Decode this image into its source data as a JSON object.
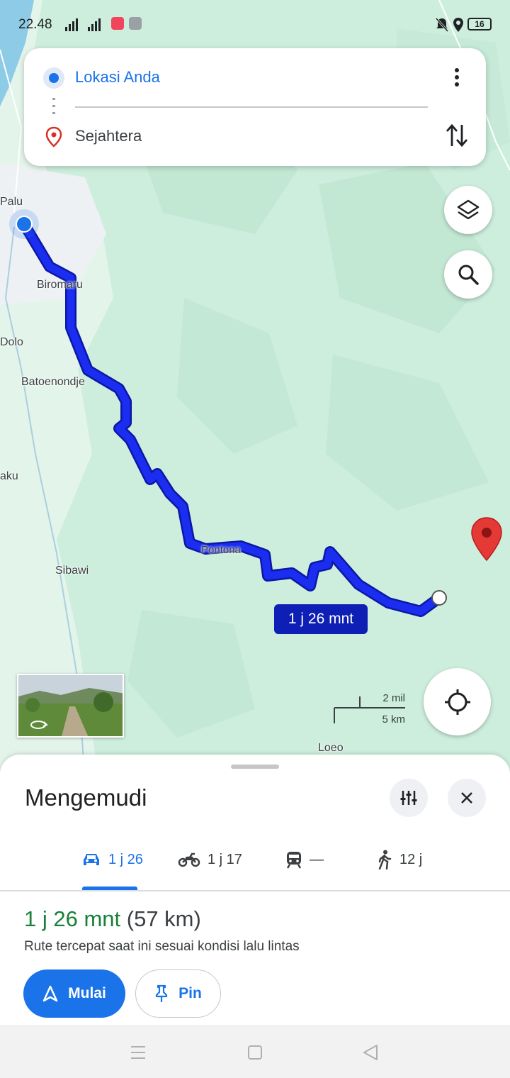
{
  "status_bar": {
    "time": "22.48",
    "battery": "16"
  },
  "route_card": {
    "origin": "Lokasi Anda",
    "destination": "Sejahtera"
  },
  "map": {
    "labels": {
      "palu": "Palu",
      "biromaru": "Biromaru",
      "dolo": "Dolo",
      "batoenondje": "Batoenondje",
      "aku": "aku",
      "sibawi": "Sibawi",
      "pontona": "Pontona",
      "loeo": "Loeo"
    },
    "route_eta": "1 j 26 mnt",
    "scale_imperial": "2 mil",
    "scale_metric": "5 km",
    "route_color": "#1a2df0",
    "destination_pin_color": "#e53935"
  },
  "sheet": {
    "title": "Mengemudi",
    "modes": [
      {
        "name": "car",
        "label": "1 j 26",
        "selected": true
      },
      {
        "name": "motorcycle",
        "label": "1 j 17",
        "selected": false
      },
      {
        "name": "transit",
        "label": "—",
        "selected": false
      },
      {
        "name": "walk",
        "label": "12 j",
        "selected": false
      }
    ],
    "summary_time": "1 j 26 mnt",
    "summary_distance": "(57 km)",
    "summary_note": "Rute tercepat saat ini sesuai kondisi lalu lintas",
    "start_label": "Mulai",
    "pin_label": "Pin"
  },
  "colors": {
    "accent": "#1a73e8",
    "time_green": "#188038",
    "map_green": "#cfeee0"
  }
}
